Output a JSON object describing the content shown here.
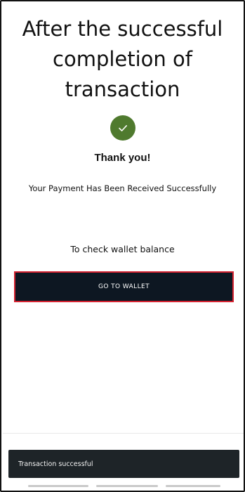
{
  "caption": {
    "lines": [
      "After the successful",
      "completion of",
      "transaction"
    ]
  },
  "success": {
    "icon": "check-circle-icon",
    "icon_color": "#4f7a2e",
    "title": "Thank you!",
    "message": "Your Payment Has Been Received Successfully"
  },
  "wallet": {
    "hint": "To check wallet balance",
    "button_label": "GO TO WALLET",
    "button_color": "#0d1722",
    "highlight_color": "#d42230"
  },
  "toast": {
    "message": "Transaction successful"
  }
}
